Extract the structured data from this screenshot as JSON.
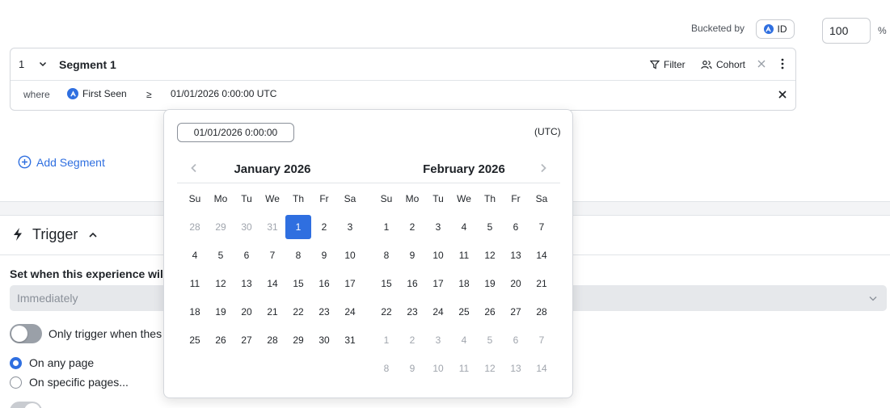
{
  "bucket": {
    "label": "Bucketed by",
    "chip": "ID",
    "percent_value": "100",
    "percent_sign": "%"
  },
  "segment": {
    "number": "1",
    "title": "Segment 1",
    "filter_label": "Filter",
    "cohort_label": "Cohort",
    "where_label": "where",
    "property": "First Seen",
    "operator": "≥",
    "value": "01/01/2026 0:00:00 UTC"
  },
  "add_segment_label": "Add Segment",
  "trigger": {
    "title": "Trigger",
    "set_when_label": "Set when this experience will",
    "timing_value": "Immediately",
    "toggle_label": "Only trigger when thes",
    "radio_any": "On any page",
    "radio_specific": "On specific pages..."
  },
  "datepicker": {
    "input_value": "01/01/2026 0:00:00",
    "timezone": "(UTC)",
    "weekdays": [
      "Su",
      "Mo",
      "Tu",
      "We",
      "Th",
      "Fr",
      "Sa"
    ],
    "months": [
      {
        "title": "January 2026",
        "days": [
          {
            "d": "28",
            "m": true
          },
          {
            "d": "29",
            "m": true
          },
          {
            "d": "30",
            "m": true
          },
          {
            "d": "31",
            "m": true
          },
          {
            "d": "1",
            "s": true
          },
          {
            "d": "2"
          },
          {
            "d": "3"
          },
          {
            "d": "4"
          },
          {
            "d": "5"
          },
          {
            "d": "6"
          },
          {
            "d": "7"
          },
          {
            "d": "8"
          },
          {
            "d": "9"
          },
          {
            "d": "10"
          },
          {
            "d": "11"
          },
          {
            "d": "12"
          },
          {
            "d": "13"
          },
          {
            "d": "14"
          },
          {
            "d": "15"
          },
          {
            "d": "16"
          },
          {
            "d": "17"
          },
          {
            "d": "18"
          },
          {
            "d": "19"
          },
          {
            "d": "20"
          },
          {
            "d": "21"
          },
          {
            "d": "22"
          },
          {
            "d": "23"
          },
          {
            "d": "24"
          },
          {
            "d": "25"
          },
          {
            "d": "26"
          },
          {
            "d": "27"
          },
          {
            "d": "28"
          },
          {
            "d": "29"
          },
          {
            "d": "30"
          },
          {
            "d": "31"
          }
        ]
      },
      {
        "title": "February 2026",
        "days": [
          {
            "d": "1"
          },
          {
            "d": "2"
          },
          {
            "d": "3"
          },
          {
            "d": "4"
          },
          {
            "d": "5"
          },
          {
            "d": "6"
          },
          {
            "d": "7"
          },
          {
            "d": "8"
          },
          {
            "d": "9"
          },
          {
            "d": "10"
          },
          {
            "d": "11"
          },
          {
            "d": "12"
          },
          {
            "d": "13"
          },
          {
            "d": "14"
          },
          {
            "d": "15"
          },
          {
            "d": "16"
          },
          {
            "d": "17"
          },
          {
            "d": "18"
          },
          {
            "d": "19"
          },
          {
            "d": "20"
          },
          {
            "d": "21"
          },
          {
            "d": "22"
          },
          {
            "d": "23"
          },
          {
            "d": "24"
          },
          {
            "d": "25"
          },
          {
            "d": "26"
          },
          {
            "d": "27"
          },
          {
            "d": "28"
          },
          {
            "d": "1",
            "m": true
          },
          {
            "d": "2",
            "m": true
          },
          {
            "d": "3",
            "m": true
          },
          {
            "d": "4",
            "m": true
          },
          {
            "d": "5",
            "m": true
          },
          {
            "d": "6",
            "m": true
          },
          {
            "d": "7",
            "m": true
          },
          {
            "d": "8",
            "m": true
          },
          {
            "d": "9",
            "m": true
          },
          {
            "d": "10",
            "m": true
          },
          {
            "d": "11",
            "m": true
          },
          {
            "d": "12",
            "m": true
          },
          {
            "d": "13",
            "m": true
          },
          {
            "d": "14",
            "m": true
          }
        ]
      }
    ]
  },
  "colors": {
    "accent": "#2f6fe0",
    "muted_text": "#a0a5ad",
    "border": "#d4d7dc"
  },
  "icons": [
    "cohort-icon",
    "chevron-down-icon",
    "filter-icon",
    "users-icon",
    "close-icon",
    "more-vertical-icon",
    "plus-circle-icon",
    "lightning-icon",
    "chevron-up-icon",
    "chevron-left-icon",
    "chevron-right-icon"
  ]
}
